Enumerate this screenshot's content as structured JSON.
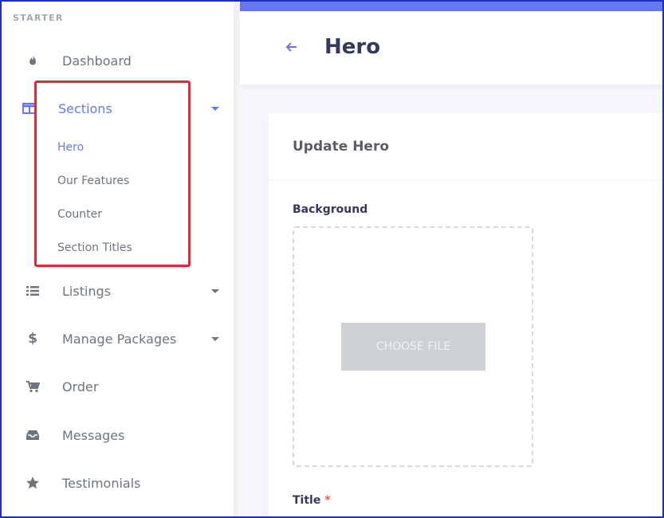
{
  "sidebar": {
    "header": "STARTER",
    "items": [
      {
        "label": "Dashboard",
        "icon": "fire-icon"
      },
      {
        "label": "Sections",
        "icon": "columns-icon"
      },
      {
        "label": "Listings",
        "icon": "list-icon"
      },
      {
        "label": "Manage Packages",
        "icon": "dollar-icon"
      },
      {
        "label": "Order",
        "icon": "cart-icon"
      },
      {
        "label": "Messages",
        "icon": "inbox-icon"
      },
      {
        "label": "Testimonials",
        "icon": "star-icon"
      }
    ],
    "sections_submenu": [
      "Hero",
      "Our Features",
      "Counter",
      "Section Titles"
    ]
  },
  "header": {
    "back_icon": "arrow-left-icon",
    "title": "Hero"
  },
  "card": {
    "title": "Update Hero",
    "background_label": "Background",
    "choose_file_label": "CHOOSE FILE",
    "title_label": "Title",
    "required_marker": "*"
  },
  "colors": {
    "accent": "#6777ef",
    "highlight": "#e8262c",
    "required": "#fc544b"
  }
}
